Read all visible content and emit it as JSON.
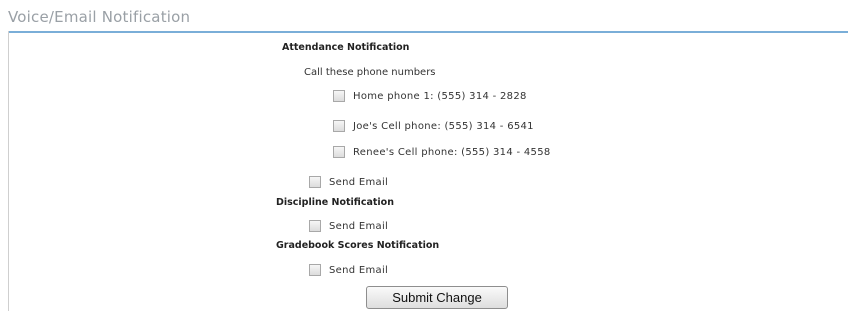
{
  "panel": {
    "title": "Voice/Email Notification"
  },
  "attendance": {
    "heading": "Attendance Notification",
    "call_label": "Call these phone numbers",
    "phones": [
      {
        "label": "Home phone 1:  (555) 314 - 2828",
        "checked": false
      },
      {
        "label": "Joe's Cell phone: (555) 314 - 6541",
        "checked": false
      },
      {
        "label": "Renee's Cell phone: (555) 314 - 4558",
        "checked": false
      }
    ],
    "email_label": "Send Email"
  },
  "discipline": {
    "heading": "Discipline Notification",
    "email_label": "Send Email"
  },
  "gradebook": {
    "heading": "Gradebook Scores Notification",
    "email_label": "Send Email"
  },
  "submit": {
    "label": "Submit Change"
  },
  "colors": {
    "title_text": "#9aa0a6",
    "title_rule": "#7aaed8"
  }
}
